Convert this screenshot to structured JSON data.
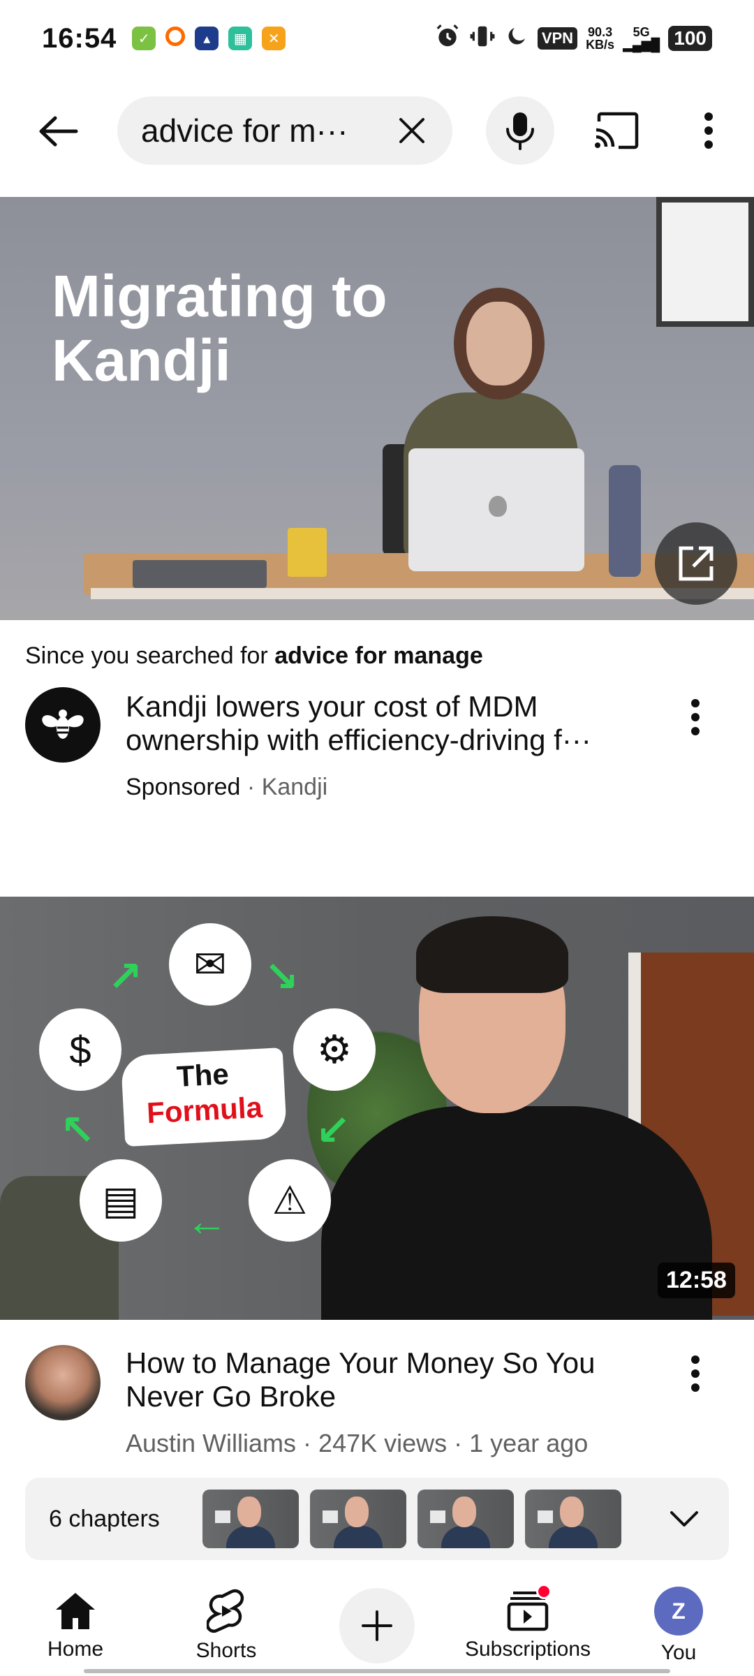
{
  "status_bar": {
    "time": "16:54",
    "vpn": "VPN",
    "speed_value": "90.3",
    "speed_unit": "KB/s",
    "network": "5G",
    "battery": "100"
  },
  "search": {
    "query": "advice for m···"
  },
  "ad": {
    "hero_title_line1": "Migrating to",
    "hero_title_line2": "Kandji",
    "since_prefix": "Since you searched for ",
    "since_query": "advice for manage",
    "title": "Kandji lowers your cost of MDM ownership with efficiency-driving f···",
    "sponsored": "Sponsored",
    "separator": " · ",
    "advertiser": "Kandji"
  },
  "video": {
    "thumb_the": "The",
    "thumb_formula": "Formula",
    "duration": "12:58",
    "title": "How to Manage Your Money So You Never Go Broke",
    "channel": "Austin Williams",
    "views": "247K views",
    "age": "1 year ago",
    "separator": " · "
  },
  "chapters": {
    "label": "6 chapters"
  },
  "nav": {
    "home": "Home",
    "shorts": "Shorts",
    "subscriptions": "Subscriptions",
    "you": "You",
    "you_initial": "Z"
  },
  "colors": {
    "accent_red": "#ff0033",
    "avatar_blue": "#5c6bc0",
    "formula_red": "#e10f1a",
    "arrow_green": "#2fd15a"
  }
}
